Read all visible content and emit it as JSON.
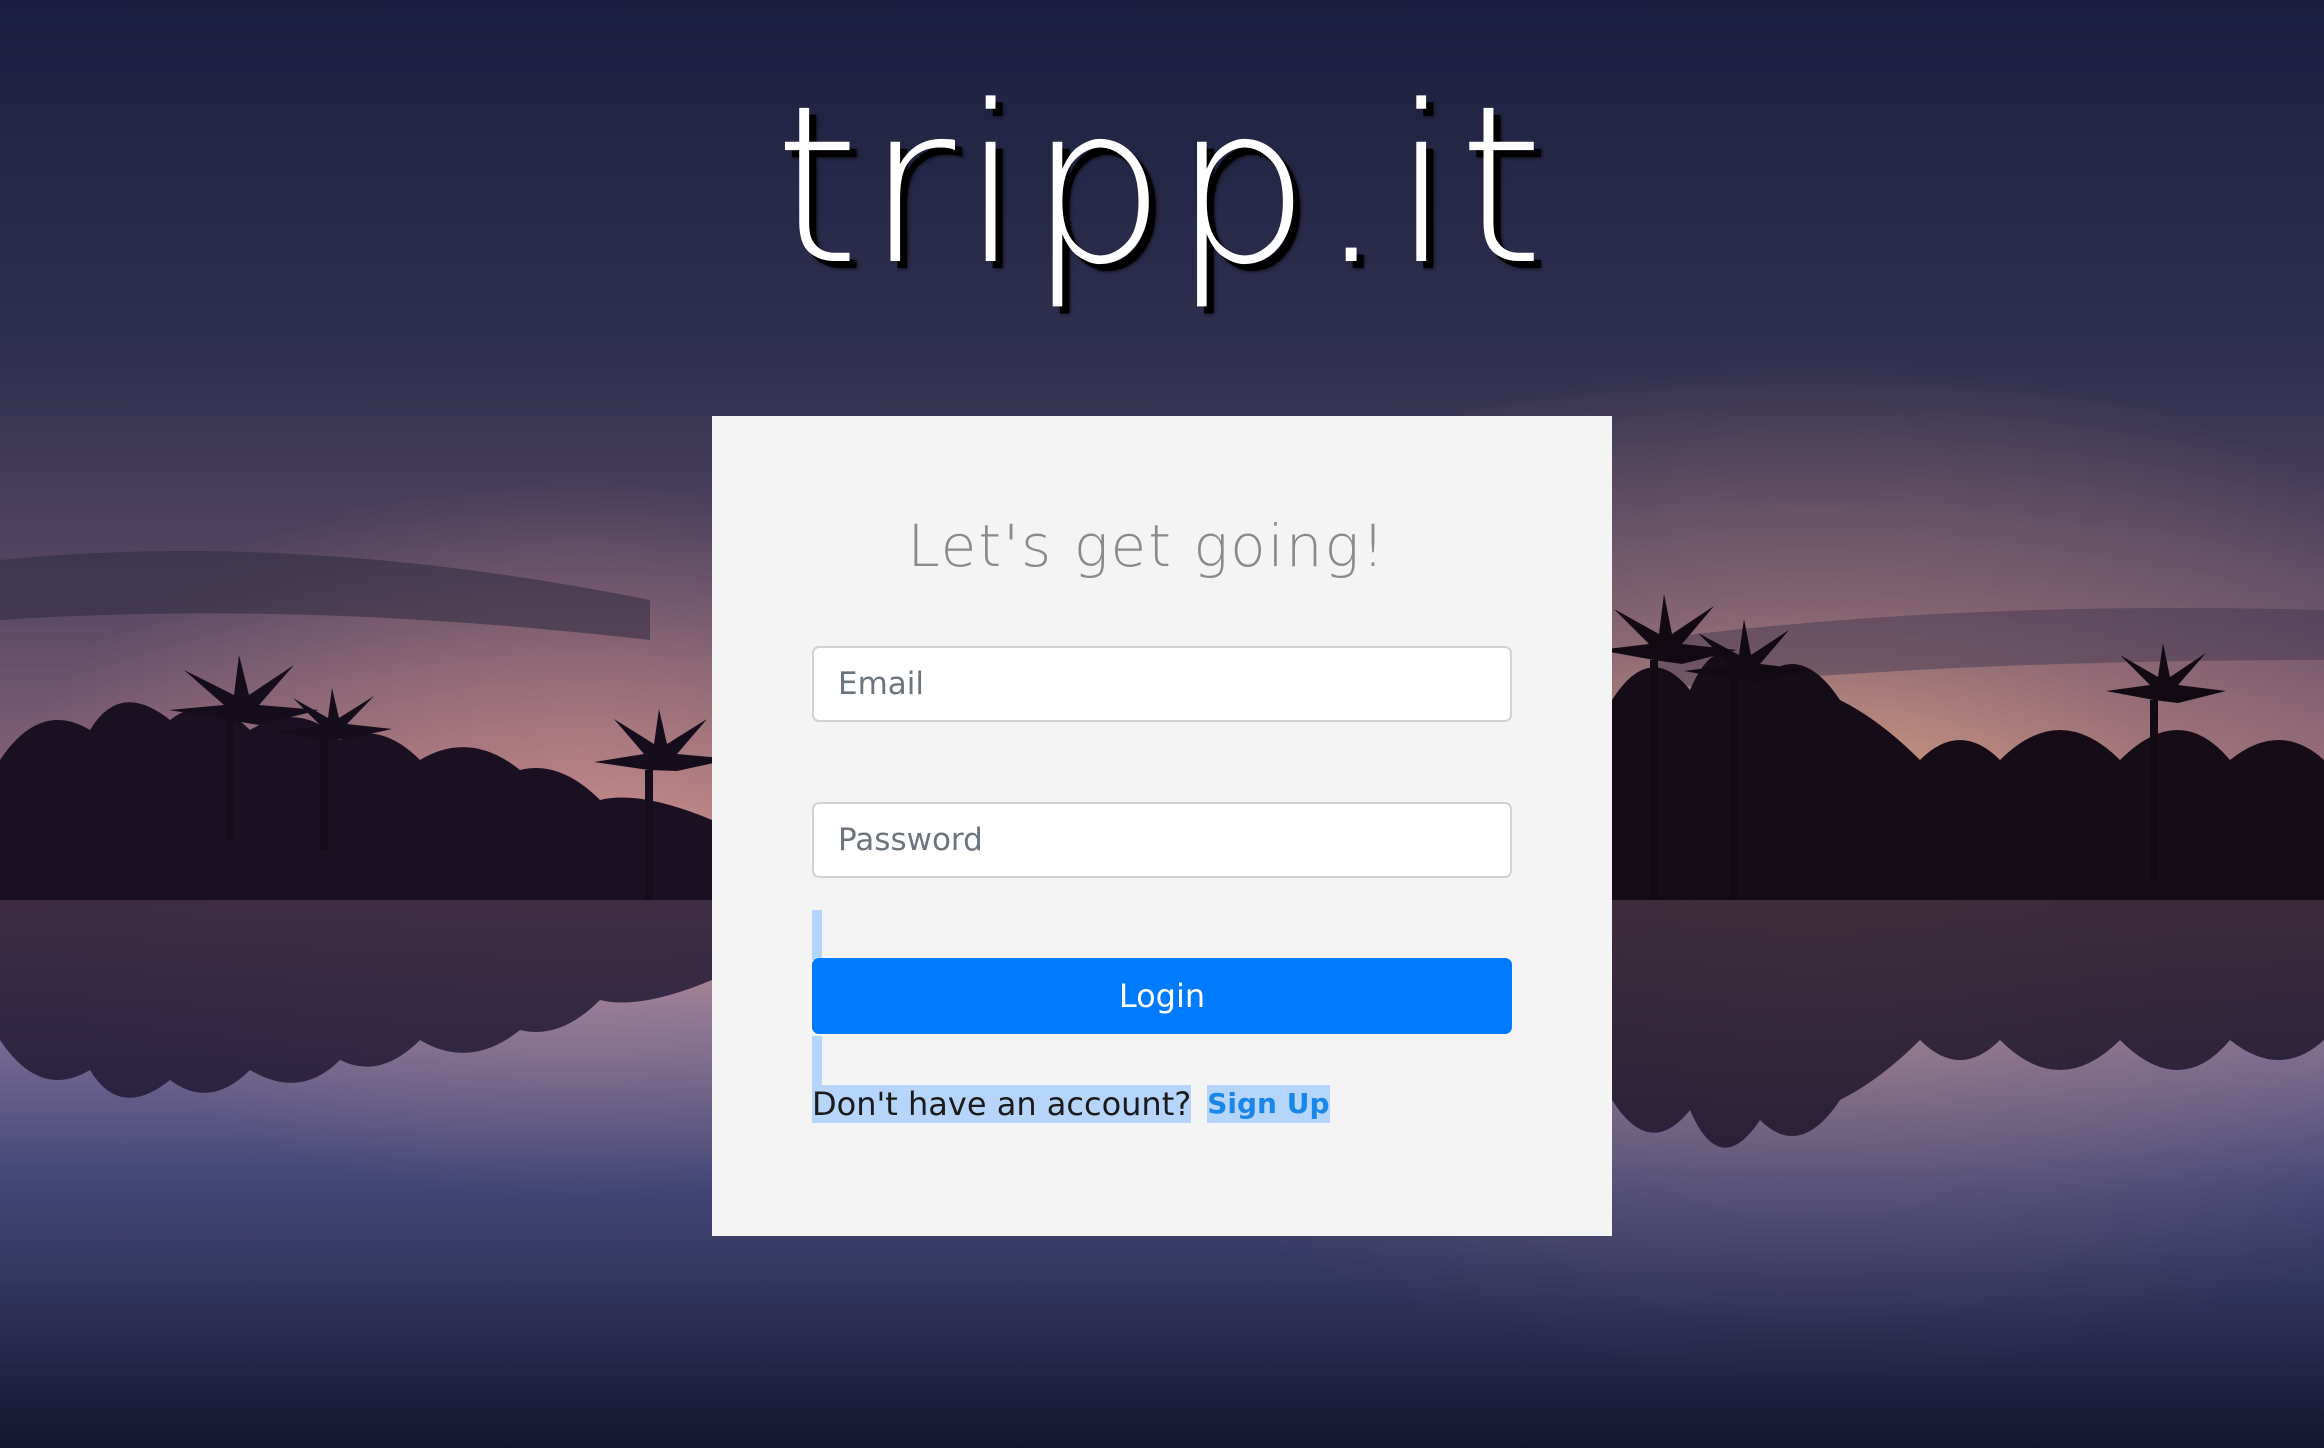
{
  "brand": {
    "logo_text": "tripp.it"
  },
  "login_card": {
    "title": "Let's get going!",
    "email_placeholder": "Email",
    "password_placeholder": "Password",
    "login_label": "Login",
    "signup_prompt": "Don't have an account?",
    "signup_link": "Sign Up"
  },
  "colors": {
    "primary": "#007bff",
    "card_background": "#f4f4f4",
    "selection_highlight": "#b6d5fb",
    "link": "#1a86e8"
  }
}
